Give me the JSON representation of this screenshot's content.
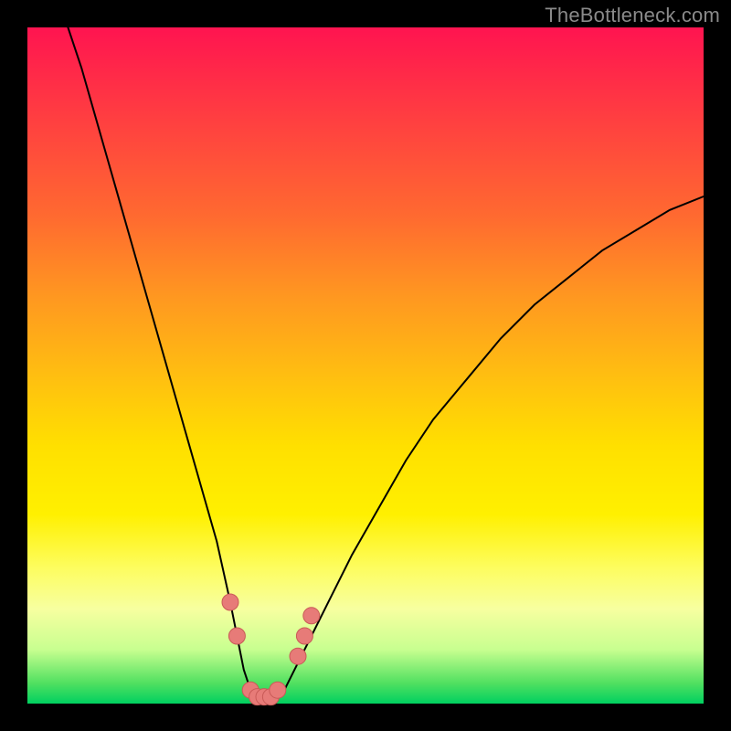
{
  "watermark": "TheBottleneck.com",
  "colors": {
    "background": "#000000",
    "curve": "#000000",
    "marker_fill": "#e77b78",
    "marker_stroke": "#c95a57",
    "gradient_top": "#ff1450",
    "gradient_bottom": "#00d060"
  },
  "chart_data": {
    "type": "line",
    "title": "",
    "xlabel": "",
    "ylabel": "",
    "xlim": [
      0,
      100
    ],
    "ylim": [
      0,
      100
    ],
    "grid": false,
    "legend": false,
    "series": [
      {
        "name": "bottleneck-curve",
        "x": [
          6,
          8,
          10,
          12,
          14,
          16,
          18,
          20,
          22,
          24,
          26,
          28,
          30,
          31,
          32,
          33,
          34,
          36,
          38,
          40,
          42,
          45,
          48,
          52,
          56,
          60,
          65,
          70,
          75,
          80,
          85,
          90,
          95,
          100
        ],
        "y": [
          100,
          94,
          87,
          80,
          73,
          66,
          59,
          52,
          45,
          38,
          31,
          24,
          15,
          10,
          5,
          2,
          0,
          0,
          2,
          6,
          10,
          16,
          22,
          29,
          36,
          42,
          48,
          54,
          59,
          63,
          67,
          70,
          73,
          75
        ]
      }
    ],
    "markers": [
      {
        "x": 30,
        "y": 15
      },
      {
        "x": 31,
        "y": 10
      },
      {
        "x": 33,
        "y": 2
      },
      {
        "x": 34,
        "y": 1
      },
      {
        "x": 35,
        "y": 1
      },
      {
        "x": 36,
        "y": 1
      },
      {
        "x": 37,
        "y": 2
      },
      {
        "x": 40,
        "y": 7
      },
      {
        "x": 41,
        "y": 10
      },
      {
        "x": 42,
        "y": 13
      }
    ]
  }
}
